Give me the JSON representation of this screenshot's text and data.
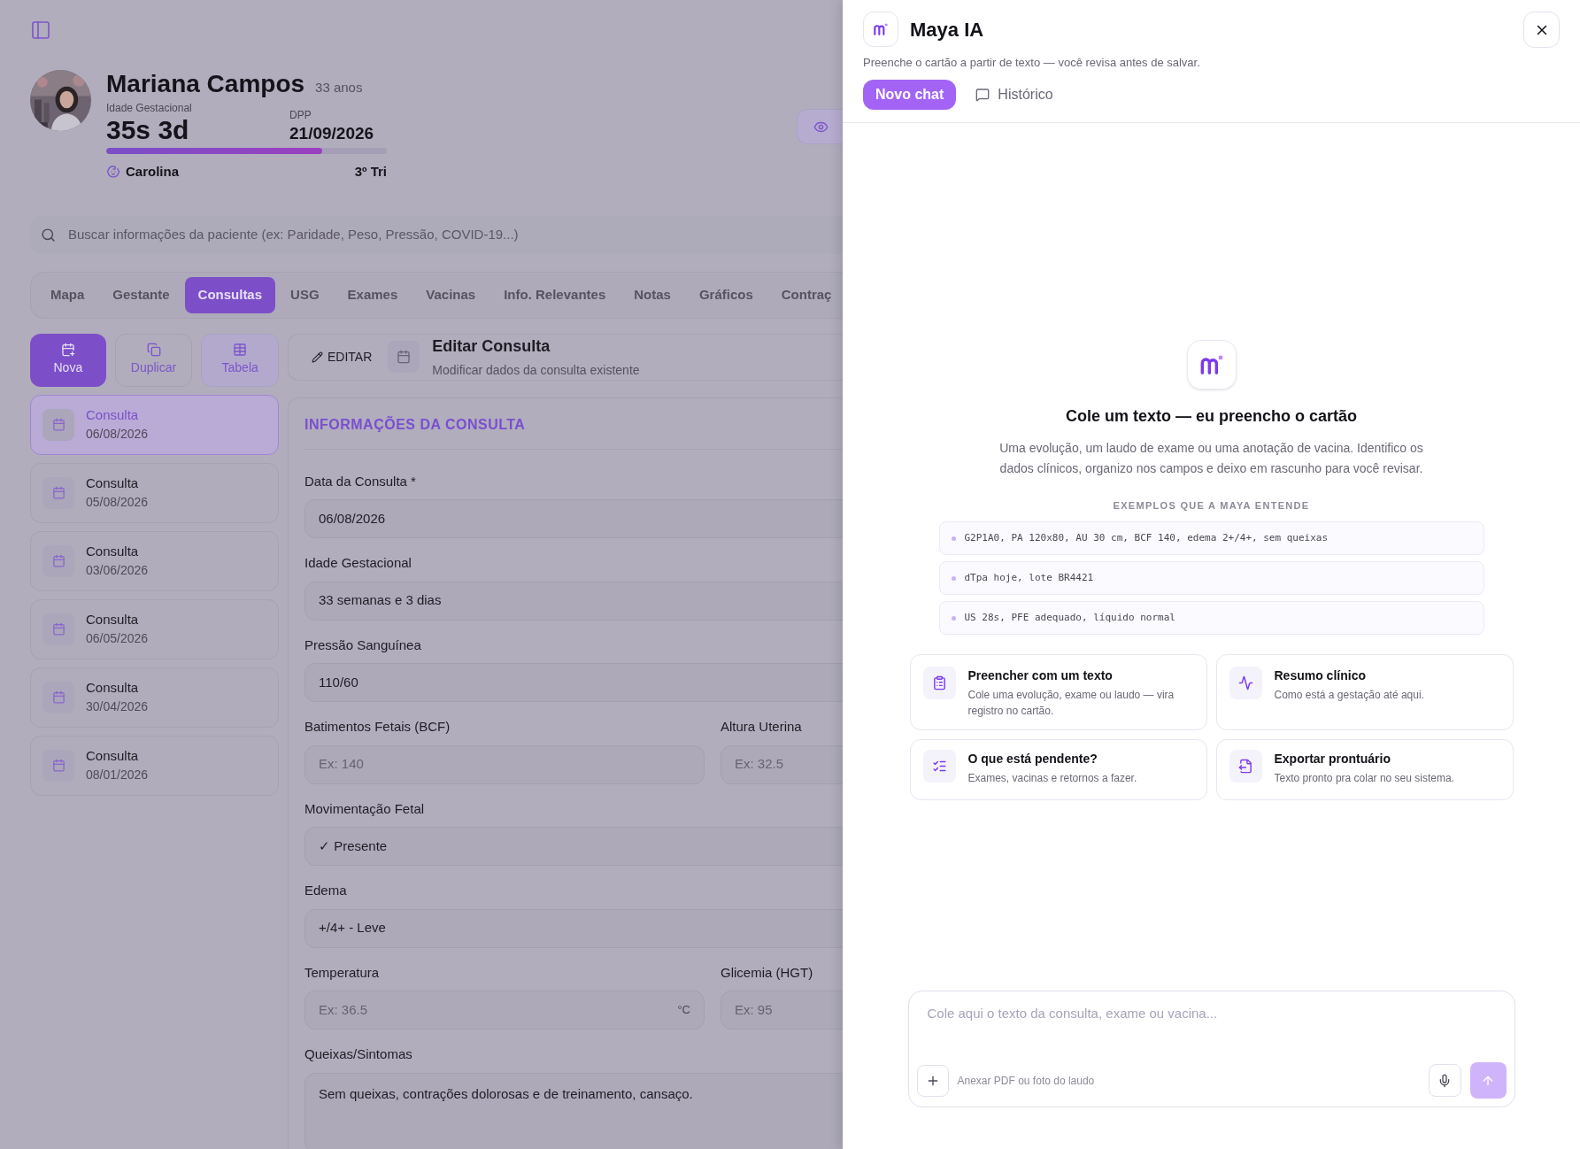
{
  "patient": {
    "name": "Mariana Campos",
    "age": "33 anos",
    "ga_label": "Idade Gestacional",
    "ga_value": "35s 3d",
    "dpp_label": "DPP",
    "dpp_value": "21/09/2026",
    "progress": {
      "level": 0.77
    },
    "baby_name": "Carolina",
    "trimester": "3º Tri"
  },
  "search": {
    "placeholder": "Buscar informações da paciente (ex: Paridade, Peso, Pressão, COVID-19...)"
  },
  "tabs": [
    {
      "label": "Mapa",
      "selected": false
    },
    {
      "label": "Gestante",
      "selected": false
    },
    {
      "label": "Consultas",
      "selected": true
    },
    {
      "label": "USG",
      "selected": false
    },
    {
      "label": "Exames",
      "selected": false
    },
    {
      "label": "Vacinas",
      "selected": false
    },
    {
      "label": "Info. Relevantes",
      "selected": false
    },
    {
      "label": "Notas",
      "selected": false
    },
    {
      "label": "Gráficos",
      "selected": false
    },
    {
      "label": "Contraç",
      "selected": false
    }
  ],
  "actions": [
    {
      "label": "Nova",
      "selected": true
    },
    {
      "label": "Duplicar",
      "selected": false
    },
    {
      "label": "Tabela",
      "selected": false
    }
  ],
  "consultations": [
    {
      "title": "Consulta",
      "date": "06/08/2026",
      "selected": true
    },
    {
      "title": "Consulta",
      "date": "05/08/2026",
      "selected": false
    },
    {
      "title": "Consulta",
      "date": "03/06/2026",
      "selected": false
    },
    {
      "title": "Consulta",
      "date": "06/05/2026",
      "selected": false
    },
    {
      "title": "Consulta",
      "date": "30/04/2026",
      "selected": false
    },
    {
      "title": "Consulta",
      "date": "08/01/2026",
      "selected": false
    }
  ],
  "editor": {
    "mode_label": "EDITAR",
    "title": "Editar Consulta",
    "subtitle": "Modificar dados da consulta existente"
  },
  "form": {
    "section_title": "INFORMAÇÕES DA CONSULTA",
    "rows": [
      {
        "fields": [
          {
            "label": "Data da Consulta *",
            "value": "06/08/2026"
          }
        ]
      },
      {
        "fields": [
          {
            "label": "Idade Gestacional",
            "value": "33 semanas e 3 dias"
          }
        ]
      },
      {
        "fields": [
          {
            "label": "Pressão Sanguínea",
            "value": "110/60"
          }
        ]
      },
      {
        "fields": [
          {
            "label": "Batimentos Fetais (BCF)",
            "placeholder": "Ex: 140"
          },
          {
            "label": "Altura Uterina",
            "placeholder": "Ex: 32.5"
          }
        ]
      },
      {
        "fields": [
          {
            "label": "Movimentação Fetal",
            "value": "✓ Presente"
          }
        ]
      },
      {
        "fields": [
          {
            "label": "Edema",
            "value": "+/4+ - Leve"
          }
        ]
      },
      {
        "fields": [
          {
            "label": "Temperatura",
            "placeholder": "Ex: 36.5",
            "unit": "°C"
          },
          {
            "label": "Glicemia (HGT)",
            "placeholder": "Ex: 95"
          }
        ]
      },
      {
        "fields": [
          {
            "label": "Queixas/Sintomas",
            "value": "Sem queixas, contrações dolorosas e de treinamento, cansaço.",
            "kind": "textarea"
          }
        ]
      }
    ]
  },
  "assistant": {
    "title": "Maya IA",
    "subtitle": "Preenche o cartão a partir de texto — você revisa antes de salvar.",
    "tabs": [
      {
        "label": "Novo chat",
        "selected": true
      },
      {
        "label": "Histórico",
        "selected": false
      }
    ],
    "hero_title": "Cole um texto — eu preencho o cartão",
    "hero_text": "Uma evolução, um laudo de exame ou uma anotação de vacina. Identifico os dados clínicos, organizo nos campos e deixo em rascunho para você revisar.",
    "examples_label": "EXEMPLOS QUE A MAYA ENTENDE",
    "examples": [
      "G2P1A0, PA 120x80, AU 30 cm, BCF 140, edema 2+/4+, sem queixas",
      "dTpa hoje, lote BR4421",
      "US 28s, PFE adequado, líquido normal"
    ],
    "suggestions": [
      {
        "title": "Preencher com um texto",
        "text": "Cole uma evolução, exame ou laudo — vira registro no cartão."
      },
      {
        "title": "Resumo clínico",
        "text": "Como está a gestação até aqui."
      },
      {
        "title": "O que está pendente?",
        "text": "Exames, vacinas e retornos a fazer."
      },
      {
        "title": "Exportar prontuário",
        "text": "Texto pronto pra colar no seu sistema."
      }
    ],
    "composer": {
      "placeholder": "Cole aqui o texto da consulta, exame ou vacina...",
      "attach_label": "Anexar PDF ou foto do laudo"
    }
  }
}
